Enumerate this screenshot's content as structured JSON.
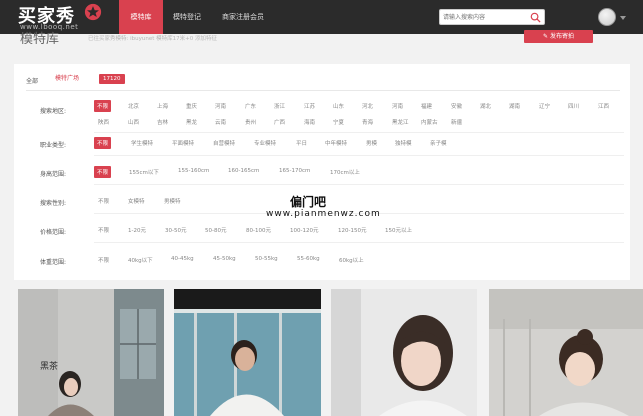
{
  "header": {
    "logo_text": "买家秀",
    "logo_url": "www.lbooq.net",
    "nav": [
      {
        "label": "模特库",
        "active": true
      },
      {
        "label": "模特登记",
        "active": false
      },
      {
        "label": "商家注册会员",
        "active": false
      }
    ],
    "search": {
      "placeholder": "请输入搜索内容"
    }
  },
  "page": {
    "title": "模特库",
    "subtitle": "已往买家秀模特: ibuyunet 模特库17米+0 添加特征",
    "post_button": "✎ 发布寄拍"
  },
  "categories": {
    "all": "全部",
    "plaza": "模特广场",
    "count": "17120"
  },
  "filters": [
    {
      "label": "搜索地区:",
      "options": [
        "不限",
        "北京",
        "上海",
        "重庆",
        "河南",
        "广东",
        "浙江",
        "江苏",
        "山东",
        "河北",
        "河南",
        "福建",
        "安徽",
        "湖北",
        "湖南",
        "辽宁",
        "四川",
        "江西",
        "陕西",
        "山西",
        "吉林",
        "黑龙",
        "云南",
        "贵州",
        "广西",
        "海南",
        "宁夏",
        "青海",
        "黑龙江",
        "内蒙古",
        "新疆"
      ]
    },
    {
      "label": "职业类型:",
      "options": [
        "不限",
        "学生模特",
        "平面模特",
        "自营模特",
        "专业模特",
        "平日",
        "中年模特",
        "男模",
        "独特模",
        "亲子模"
      ]
    },
    {
      "label": "身高范围:",
      "options": [
        "不限",
        "155cm以下",
        "155-160cm",
        "160-165cm",
        "165-170cm",
        "170cm以上"
      ]
    },
    {
      "label": "搜索性别:",
      "options": [
        "不限",
        "女模特",
        "男模特"
      ]
    },
    {
      "label": "价格范围:",
      "options": [
        "不限",
        "1-20元",
        "30-50元",
        "50-80元",
        "80-100元",
        "100-120元",
        "120-150元",
        "150元以上"
      ]
    },
    {
      "label": "体重范围:",
      "options": [
        "不限",
        "40kg以下",
        "40-45kg",
        "45-50kg",
        "50-55kg",
        "55-60kg",
        "60kg以上"
      ]
    }
  ],
  "watermark": {
    "title": "偏门吧",
    "url": "www.pianmenwz.com"
  },
  "photos": [
    {
      "caption": "黑茶"
    },
    {
      "caption": ""
    },
    {
      "caption": ""
    },
    {
      "caption": ""
    }
  ],
  "colors": {
    "accent": "#d9414f",
    "topbar": "#2b2b2b",
    "page_bg": "#f2f2f2"
  }
}
